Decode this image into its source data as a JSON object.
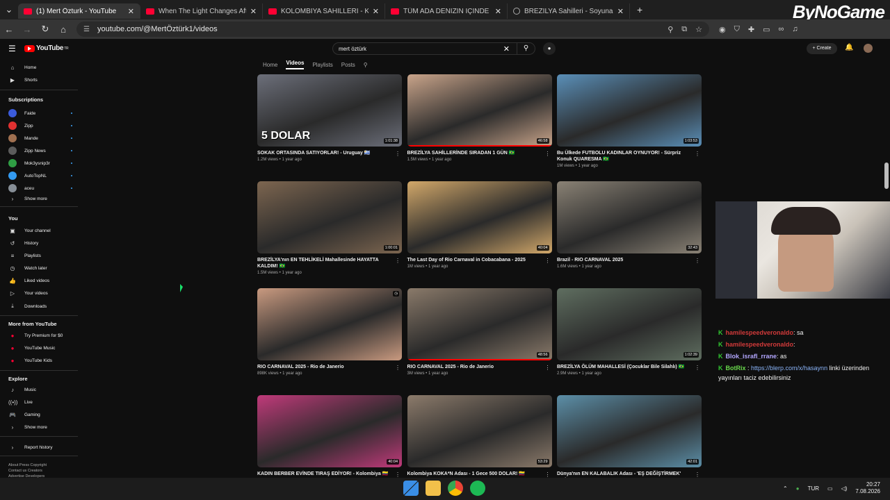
{
  "browser": {
    "tabs": [
      {
        "title": "(1) Mert Özturk - YouTube",
        "active": true,
        "icon": "youtube-icon"
      },
      {
        "title": "When The Light Changes After |",
        "active": false,
        "icon": "youtube-icon"
      },
      {
        "title": "KOLOMBİYA SAHİLLERİ - Korsan",
        "active": false,
        "icon": "youtube-icon"
      },
      {
        "title": "TÜM ADA DENİZİN İÇİNDE PAR",
        "active": false,
        "icon": "youtube-icon"
      },
      {
        "title": "BREZİLYA Sahilleri - Soyunanlar",
        "active": false,
        "icon": "globe-icon"
      }
    ],
    "url": "youtube.com/@MertÖztürk1/videos",
    "overlay_brand": "ByNoGame"
  },
  "youtube": {
    "logo": "YouTube",
    "logo_sup": "TR",
    "search_value": "mert öztürk",
    "create_label": "Create",
    "channel_tabs": [
      "Home",
      "Videos",
      "Playlists",
      "Posts"
    ],
    "active_tab": "Videos"
  },
  "sidebar": {
    "top": [
      {
        "label": "Home",
        "icon": "home-icon"
      },
      {
        "label": "Shorts",
        "icon": "shorts-icon"
      }
    ],
    "subscriptions_title": "Subscriptions",
    "subscriptions": [
      {
        "label": "Faide",
        "color": "#3b5bdb"
      },
      {
        "label": "Zipp",
        "color": "#e03131"
      },
      {
        "label": "Mande",
        "color": "#a07050"
      },
      {
        "label": "Zipp News",
        "color": "#5c5c5c"
      },
      {
        "label": "Mok3ysnip3r",
        "color": "#2f9e44"
      },
      {
        "label": "AutoTopNL",
        "color": "#339af0"
      },
      {
        "label": "aceu",
        "color": "#868e96"
      }
    ],
    "show_more": "Show more",
    "you_title": "You",
    "you": [
      {
        "label": "Your channel",
        "icon": "channel-icon"
      },
      {
        "label": "History",
        "icon": "history-icon"
      },
      {
        "label": "Playlists",
        "icon": "playlists-icon"
      },
      {
        "label": "Watch later",
        "icon": "watch-later-icon"
      },
      {
        "label": "Liked videos",
        "icon": "like-icon"
      },
      {
        "label": "Your videos",
        "icon": "your-videos-icon"
      },
      {
        "label": "Downloads",
        "icon": "download-icon"
      }
    ],
    "more_title": "More from YouTube",
    "more": [
      {
        "label": "Try Premium for $0"
      },
      {
        "label": "YouTube Music"
      },
      {
        "label": "YouTube Kids"
      }
    ],
    "explore_title": "Explore",
    "explore": [
      {
        "label": "Music",
        "icon": "music-icon"
      },
      {
        "label": "Live",
        "icon": "live-icon"
      },
      {
        "label": "Gaming",
        "icon": "gaming-icon"
      }
    ],
    "explore_more": "Show more",
    "report": "Report history",
    "footer": "About  Press  Copyright\nContact us  Creators\nAdvertise  Developers"
  },
  "videos": [
    {
      "title": "SOKAK ORTASINDA SATIYORLAR! - Uruguay 🇺🇾",
      "meta": "1.2M views • 1 year ago",
      "duration": "1:01:38",
      "progress": 0
    },
    {
      "title": "BREZİLYA SAHİLLERİNDE SIRADAN 1 GÜN 🇧🇷",
      "meta": "1.5M views • 1 year ago",
      "duration": "46:58",
      "progress": 1
    },
    {
      "title": "Bu Ülkede FUTBOLU KADINLAR OYNUYOR! - Sürpriz Konuk QUARESMA 🇧🇷",
      "meta": "1M views • 1 year ago",
      "duration": "1:03:53",
      "progress": 0
    },
    {
      "title": "BREZİLYA'nın EN TEHLİKELİ Mahallesinde HAYATTA KALDIM! 🇧🇷",
      "meta": "1.5M views • 1 year ago",
      "duration": "1:00:01",
      "progress": 0
    },
    {
      "title": "The Last Day of Rio Carnaval in Cobacabana - 2025",
      "meta": "1M views • 1 year ago",
      "duration": "40:04",
      "progress": 0
    },
    {
      "title": "Brazil - RIO CARNAVAL 2025",
      "meta": "1.6M views • 1 year ago",
      "duration": "32:43",
      "progress": 0
    },
    {
      "title": "RIO CARNAVAL 2025 - Rio de Janerio",
      "meta": "898K views • 1 year ago",
      "duration": "",
      "progress": 0
    },
    {
      "title": "RIO CARNAVAL 2025 - Rio de Janerio",
      "meta": "3M views • 1 year ago",
      "duration": "48:56",
      "progress": 1
    },
    {
      "title": "BREZİLYA ÖLÜM MAHALLESİ (Çocuklar Bile Silahlı) 🇧🇷",
      "meta": "2.9M views • 1 year ago",
      "duration": "1:02:39",
      "progress": 0
    },
    {
      "title": "KADIN BERBER EVİNDE TIRAŞ EDİYOR! - Kolombiya 🇨🇴",
      "meta": "832K views • 1 year ago",
      "duration": "40:04",
      "progress": 0
    },
    {
      "title": "Kolombiya KOKA*N Adası - 1 Gece 500 DOLAR! 🇨🇴",
      "meta": "2.5M views • 1 year ago",
      "duration": "53:29",
      "progress": 0
    },
    {
      "title": "Dünya'nın EN KALABALIK Adası - 'EŞ DEĞİŞTİRMEK' Serbest!",
      "meta": "",
      "duration": "42:01",
      "progress": 0
    }
  ],
  "thumb_colors": [
    "#6c6f7a",
    "#c9a48a",
    "#5a8fb8",
    "#7d6650",
    "#d2a86a",
    "#8a8275",
    "#c99a80",
    "#8a7a6a",
    "#5f6e60",
    "#c03a7a",
    "#8c7b6b",
    "#5c8fa8"
  ],
  "thumb_text": {
    "first": "5 DOLAR"
  },
  "chat": [
    {
      "user": "hamilespeedveronaldo",
      "msg": ": sa",
      "style": "u1"
    },
    {
      "user": "hamilespeedveronaldo",
      "msg": ":",
      "style": "u1"
    },
    {
      "user": "Blok_israfl_rrane",
      "msg": ": as",
      "style": "u2"
    },
    {
      "user": "BotRix",
      "msg": " : ",
      "link": "https://blerp.com/x/hasaynn",
      "after": " linki üzerinden yayınları taciz edebilirsiniz",
      "style": "u3"
    }
  ],
  "taskbar": {
    "lang": "TUR",
    "time": "20:27",
    "date": "7.08.2026"
  }
}
